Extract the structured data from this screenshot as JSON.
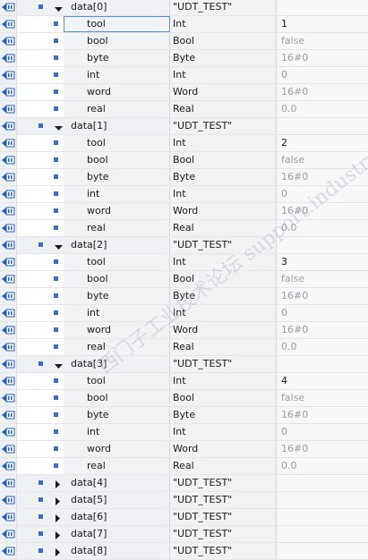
{
  "rows": [
    {
      "level": 0,
      "expanded": true,
      "name": "data[0]",
      "type": "\"UDT_TEST\"",
      "value": ""
    },
    {
      "level": 1,
      "name": "tool",
      "type": "Int",
      "value": "1",
      "value_dim": false,
      "selected": true
    },
    {
      "level": 1,
      "name": "bool",
      "type": "Bool",
      "value": "false",
      "value_dim": true
    },
    {
      "level": 1,
      "name": "byte",
      "type": "Byte",
      "value": "16#0",
      "value_dim": true
    },
    {
      "level": 1,
      "name": "int",
      "type": "Int",
      "value": "0",
      "value_dim": true
    },
    {
      "level": 1,
      "name": "word",
      "type": "Word",
      "value": "16#0",
      "value_dim": true
    },
    {
      "level": 1,
      "name": "real",
      "type": "Real",
      "value": "0.0",
      "value_dim": true
    },
    {
      "level": 0,
      "expanded": true,
      "name": "data[1]",
      "type": "\"UDT_TEST\"",
      "value": ""
    },
    {
      "level": 1,
      "name": "tool",
      "type": "Int",
      "value": "2",
      "value_dim": false
    },
    {
      "level": 1,
      "name": "bool",
      "type": "Bool",
      "value": "false",
      "value_dim": true
    },
    {
      "level": 1,
      "name": "byte",
      "type": "Byte",
      "value": "16#0",
      "value_dim": true
    },
    {
      "level": 1,
      "name": "int",
      "type": "Int",
      "value": "0",
      "value_dim": true
    },
    {
      "level": 1,
      "name": "word",
      "type": "Word",
      "value": "16#0",
      "value_dim": true
    },
    {
      "level": 1,
      "name": "real",
      "type": "Real",
      "value": "0.0",
      "value_dim": true
    },
    {
      "level": 0,
      "expanded": true,
      "name": "data[2]",
      "type": "\"UDT_TEST\"",
      "value": ""
    },
    {
      "level": 1,
      "name": "tool",
      "type": "Int",
      "value": "3",
      "value_dim": false
    },
    {
      "level": 1,
      "name": "bool",
      "type": "Bool",
      "value": "false",
      "value_dim": true
    },
    {
      "level": 1,
      "name": "byte",
      "type": "Byte",
      "value": "16#0",
      "value_dim": true
    },
    {
      "level": 1,
      "name": "int",
      "type": "Int",
      "value": "0",
      "value_dim": true
    },
    {
      "level": 1,
      "name": "word",
      "type": "Word",
      "value": "16#0",
      "value_dim": true
    },
    {
      "level": 1,
      "name": "real",
      "type": "Real",
      "value": "0.0",
      "value_dim": true
    },
    {
      "level": 0,
      "expanded": true,
      "name": "data[3]",
      "type": "\"UDT_TEST\"",
      "value": ""
    },
    {
      "level": 1,
      "name": "tool",
      "type": "Int",
      "value": "4",
      "value_dim": false
    },
    {
      "level": 1,
      "name": "bool",
      "type": "Bool",
      "value": "false",
      "value_dim": true
    },
    {
      "level": 1,
      "name": "byte",
      "type": "Byte",
      "value": "16#0",
      "value_dim": true
    },
    {
      "level": 1,
      "name": "int",
      "type": "Int",
      "value": "0",
      "value_dim": true
    },
    {
      "level": 1,
      "name": "word",
      "type": "Word",
      "value": "16#0",
      "value_dim": true
    },
    {
      "level": 1,
      "name": "real",
      "type": "Real",
      "value": "0.0",
      "value_dim": true
    },
    {
      "level": 0,
      "expanded": false,
      "name": "data[4]",
      "type": "\"UDT_TEST\"",
      "value": ""
    },
    {
      "level": 0,
      "expanded": false,
      "name": "data[5]",
      "type": "\"UDT_TEST\"",
      "value": ""
    },
    {
      "level": 0,
      "expanded": false,
      "name": "data[6]",
      "type": "\"UDT_TEST\"",
      "value": ""
    },
    {
      "level": 0,
      "expanded": false,
      "name": "data[7]",
      "type": "\"UDT_TEST\"",
      "value": ""
    },
    {
      "level": 0,
      "expanded": false,
      "name": "data[8]",
      "type": "\"UDT_TEST\"",
      "value": ""
    }
  ],
  "icons": {
    "row_icon": "db-parameter-icon",
    "bullet": "member-bullet-icon",
    "expanded": "expand-down-arrow-icon",
    "collapsed": "collapse-right-arrow-icon"
  },
  "colors": {
    "bullet": "#3d6cc6",
    "icon_blue": "#1f5fbf",
    "selection_outline": "#5b8fd4",
    "dim_value": "#9a9ea5"
  },
  "watermark": "西门子工业技术论坛 support.industry.siemens.com/cs"
}
